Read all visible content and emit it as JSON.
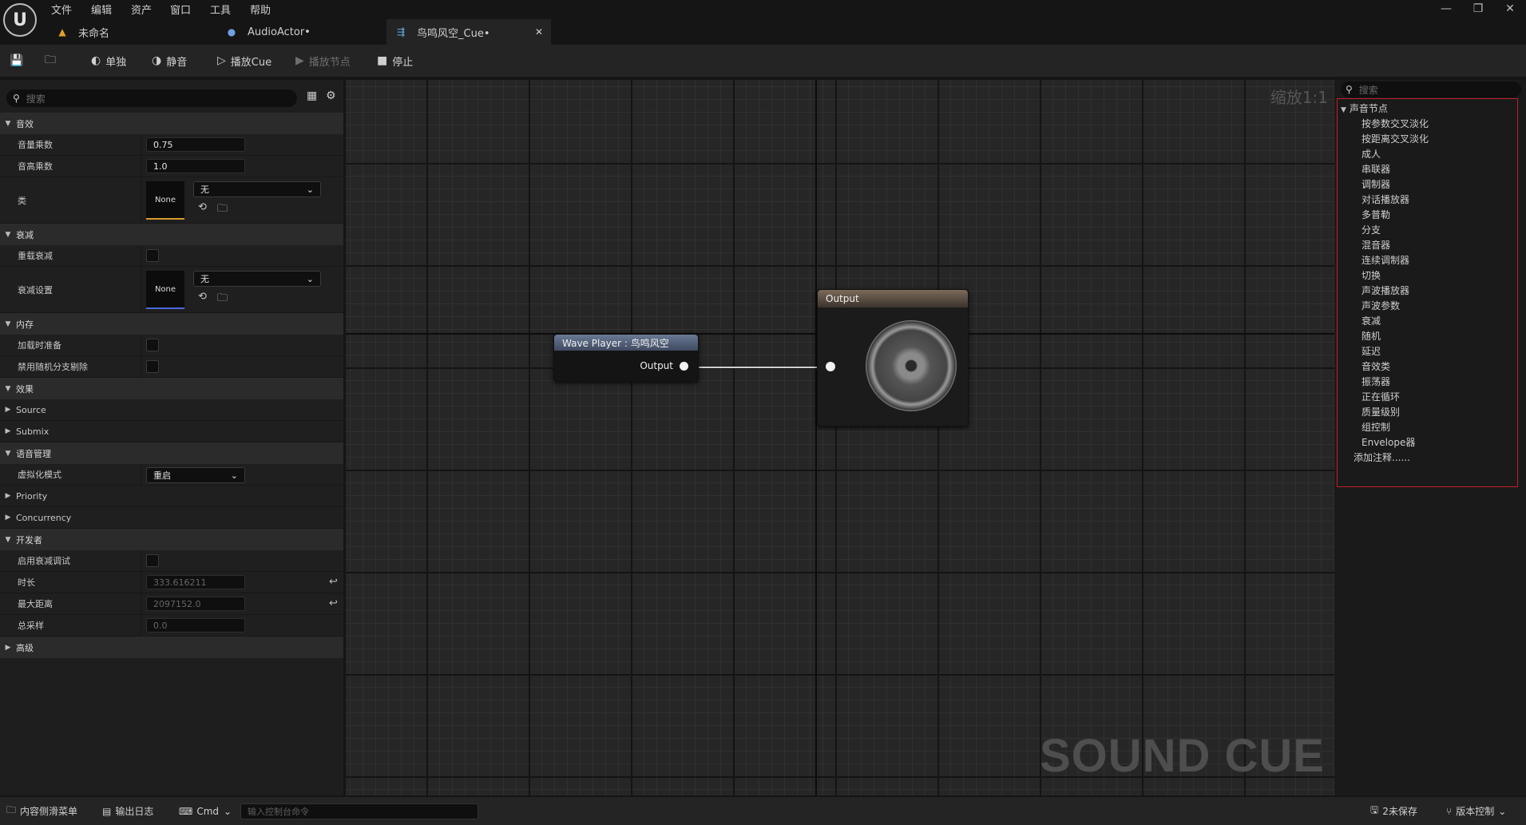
{
  "menu": [
    "文件",
    "编辑",
    "资产",
    "窗口",
    "工具",
    "帮助"
  ],
  "tabs": [
    {
      "label": "未命名",
      "icon": "level-icon"
    },
    {
      "label": "AudioActor•",
      "icon": "actor-icon"
    },
    {
      "label": "鸟鸣风空_Cue•",
      "icon": "sound-cue-icon",
      "active": true
    }
  ],
  "toolbar": {
    "solo": "单独",
    "mute": "静音",
    "play_cue": "播放Cue",
    "play_node": "播放节点",
    "stop": "停止"
  },
  "details": {
    "search_placeholder": "搜索",
    "sections": {
      "sound": "音效",
      "attenuation": "衰减",
      "memory": "内存",
      "effects": "效果",
      "source": "Source",
      "submix": "Submix",
      "voice_management": "语音管理",
      "priority": "Priority",
      "concurrency": "Concurrency",
      "developer": "开发者",
      "advanced": "高级"
    },
    "props": {
      "volume_multiplier": {
        "label": "音量乘数",
        "value": "0.75"
      },
      "pitch_multiplier": {
        "label": "音高乘数",
        "value": "1.0"
      },
      "class": {
        "label": "类",
        "thumb": "None",
        "value": "无"
      },
      "override_attenuation": {
        "label": "重载衰减"
      },
      "attenuation_settings": {
        "label": "衰减设置",
        "thumb": "None",
        "value": "无"
      },
      "prime_on_load": {
        "label": "加载时准备"
      },
      "disable_random_branch_culling": {
        "label": "禁用随机分支剔除"
      },
      "virtualization_mode": {
        "label": "虚拟化模式",
        "value": "重启"
      },
      "enable_attenuation_debug": {
        "label": "启用衰减调试"
      },
      "duration": {
        "label": "时长",
        "value": "333.616211"
      },
      "max_distance": {
        "label": "最大距离",
        "value": "2097152.0"
      },
      "total_samples": {
        "label": "总采样",
        "value": "0.0"
      }
    }
  },
  "graph": {
    "zoom": "缩放1:1",
    "watermark": "SOUND CUE",
    "wave_node": {
      "title": "Wave Player : 鸟鸣风空",
      "pin": "Output"
    },
    "output_node": {
      "title": "Output"
    }
  },
  "palette": {
    "search_placeholder": "搜索",
    "category": "声音节点",
    "items": [
      "按参数交叉淡化",
      "按距离交叉淡化",
      "成人",
      "串联器",
      "调制器",
      "对话播放器",
      "多普勒",
      "分支",
      "混音器",
      "连续调制器",
      "切换",
      "声波播放器",
      "声波参数",
      "衰减",
      "随机",
      "延迟",
      "音效类",
      "振荡器",
      "正在循环",
      "质量级别",
      "组控制",
      "Envelope器"
    ],
    "add_comment": "添加注释......"
  },
  "status": {
    "content_drawer": "内容侧滑菜单",
    "output_log": "输出日志",
    "cmd": "Cmd",
    "cmd_placeholder": "输入控制台命令",
    "unsaved": "2未保存",
    "source_control": "版本控制"
  }
}
